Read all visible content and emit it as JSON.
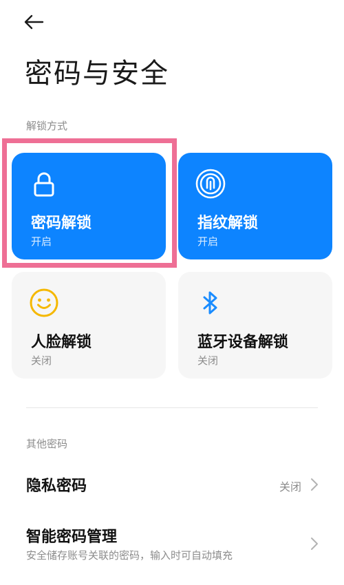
{
  "header": {
    "back_icon": "arrow-left-icon",
    "title": "密码与安全"
  },
  "unlock_section": {
    "label": "解锁方式",
    "tiles": [
      {
        "icon": "lock-icon",
        "title": "密码解锁",
        "status": "开启",
        "active": true,
        "highlighted": true
      },
      {
        "icon": "fingerprint-icon",
        "title": "指纹解锁",
        "status": "开启",
        "active": true
      },
      {
        "icon": "smile-icon",
        "title": "人脸解锁",
        "status": "关闭",
        "active": false
      },
      {
        "icon": "bluetooth-icon",
        "title": "蓝牙设备解锁",
        "status": "关闭",
        "active": false
      }
    ]
  },
  "other_section": {
    "label": "其他密码",
    "items": [
      {
        "title": "隐私密码",
        "value": "关闭",
        "icon": "chevron-right-icon"
      },
      {
        "title": "智能密码管理",
        "subtitle": "安全储存账号关联的密码，输入时可自动填充",
        "icon": "chevron-right-icon"
      }
    ]
  },
  "colors": {
    "accent": "#0d84ff",
    "tile_inactive": "#f6f6f6",
    "highlight": "#ee6f95",
    "smile_icon": "#f5b800",
    "bluetooth_icon": "#1a8cff"
  }
}
